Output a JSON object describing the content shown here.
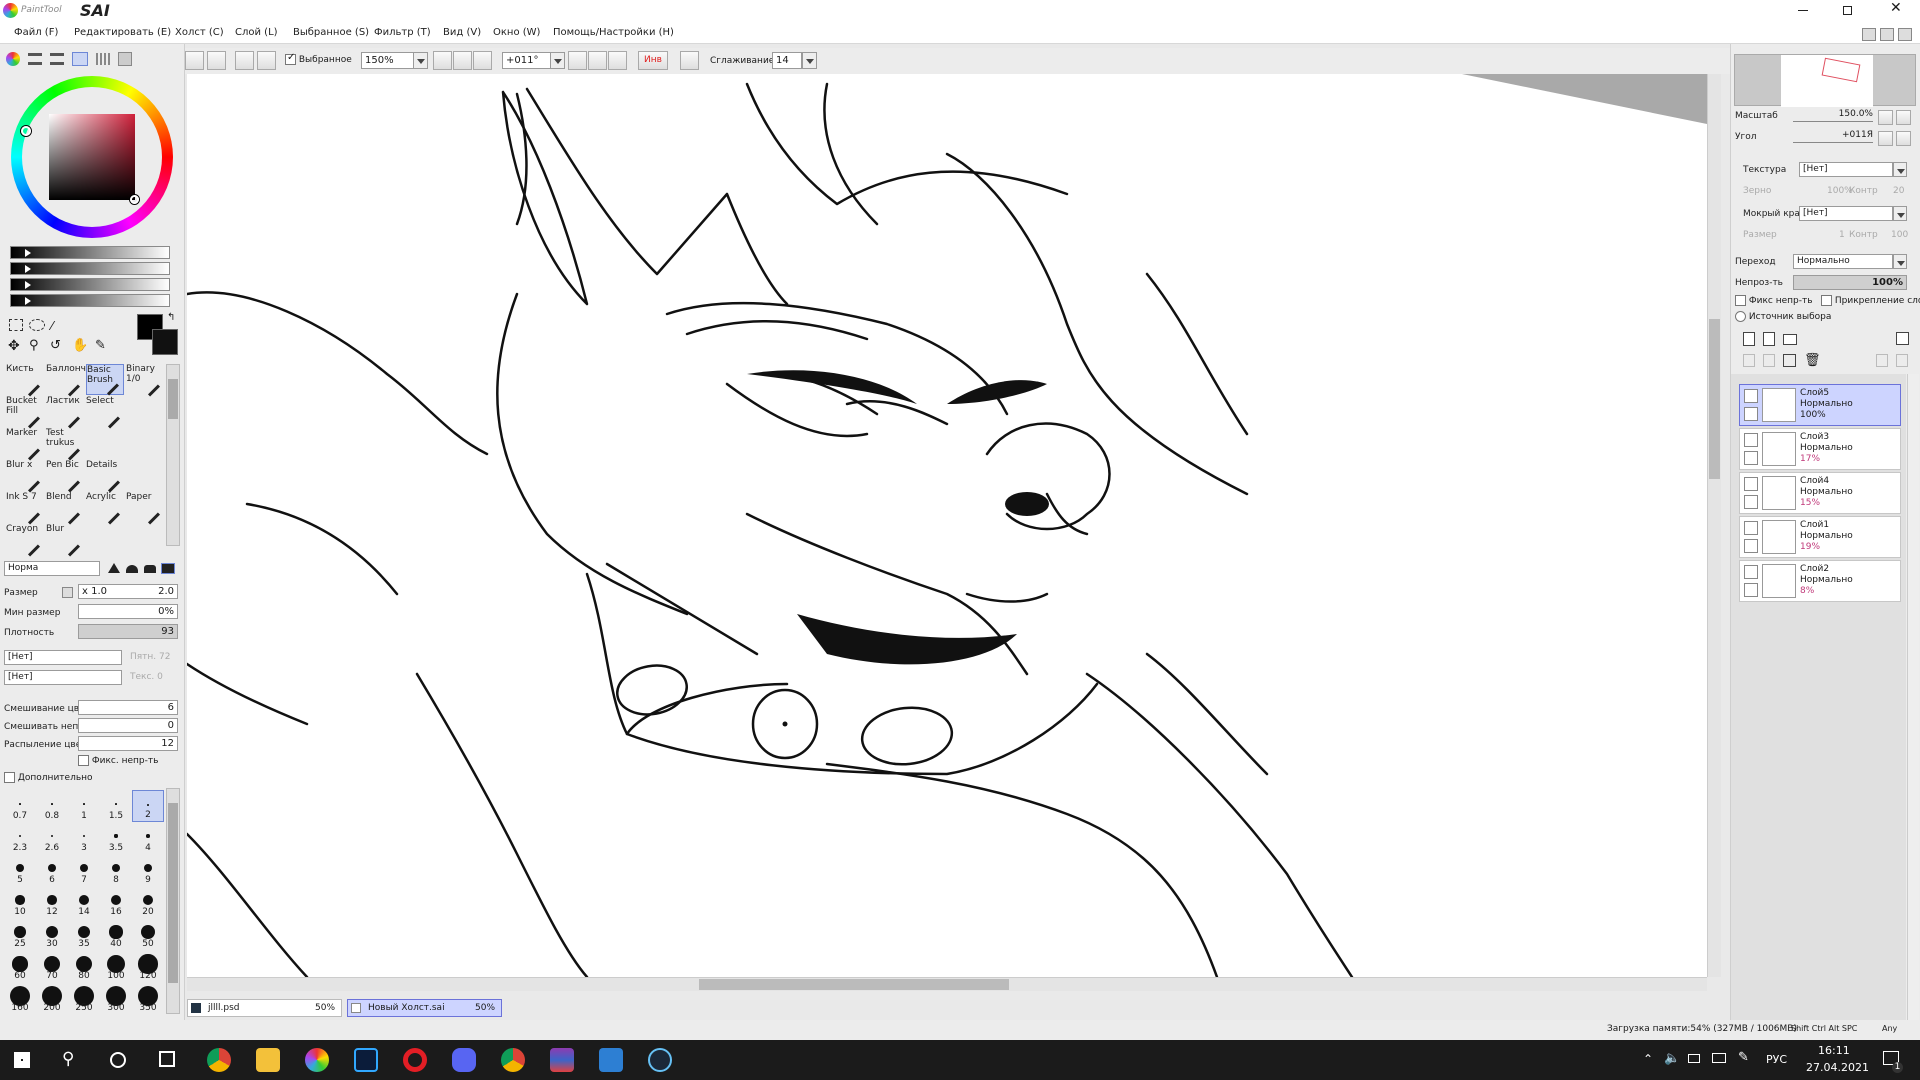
{
  "app": {
    "logo_text": "PaintTool",
    "logo_title": "SAI"
  },
  "menu": [
    {
      "label": "Файл (F)"
    },
    {
      "label": "Редактировать (E)"
    },
    {
      "label": "Холст (C)"
    },
    {
      "label": "Слой (L)"
    },
    {
      "label": "Выбранное (S)"
    },
    {
      "label": "Фильтр (T)"
    },
    {
      "label": "Вид (V)"
    },
    {
      "label": "Окно (W)"
    },
    {
      "label": "Помощь/Настройки (H)"
    }
  ],
  "toolbar": {
    "selection_label": "Выбранное",
    "zoom_value": "150%",
    "rotation_value": "+011°",
    "invert_label": "Инв",
    "smoothing_label": "Сглаживание",
    "smoothing_value": "14"
  },
  "tools": [
    {
      "label": "Кисть",
      "icon": "brush-icon"
    },
    {
      "label": "Баллонч",
      "icon": "airbrush-icon"
    },
    {
      "label": "Basic Brush",
      "icon": "basic-brush-icon"
    },
    {
      "label": "Binary 1/0",
      "icon": "pencil-icon"
    },
    {
      "label": "Bucket Fill",
      "icon": "bucket-icon"
    },
    {
      "label": "Ластик",
      "icon": "eraser-icon"
    },
    {
      "label": "Select",
      "icon": "select-icon"
    },
    {
      "label": "",
      "icon": ""
    },
    {
      "label": "Marker",
      "icon": "marker-icon"
    },
    {
      "label": "Test trukus",
      "icon": "pen-icon"
    },
    {
      "label": "",
      "icon": ""
    },
    {
      "label": "",
      "icon": ""
    },
    {
      "label": "Blur x",
      "icon": "blur-icon"
    },
    {
      "label": "Pen Bic",
      "icon": "pen-icon"
    },
    {
      "label": "Details",
      "icon": "details-icon"
    },
    {
      "label": "",
      "icon": ""
    },
    {
      "label": "Ink S 7",
      "icon": "ink-icon"
    },
    {
      "label": "Blend",
      "icon": "blend-icon"
    },
    {
      "label": "Acrylic",
      "icon": "acrylic-icon"
    },
    {
      "label": "Paper",
      "icon": "paper-icon"
    },
    {
      "label": "Crayon",
      "icon": "crayon-icon"
    },
    {
      "label": "Blur",
      "icon": "blur-icon"
    },
    {
      "label": "",
      "icon": ""
    },
    {
      "label": "",
      "icon": ""
    }
  ],
  "brush": {
    "mode": "Норма",
    "size_label": "Размер",
    "size_mult": "x 1.0",
    "size_value": "2.0",
    "min_size_label": "Мин размер",
    "min_size_value": "0%",
    "density_label": "Плотность",
    "density_value": "93",
    "shape_1": "[Нет]",
    "shape_1_param": "Пятн. 72",
    "shape_2": "[Нет]",
    "shape_2_param": "Текс. 0",
    "blend_label": "Смешивание цвет",
    "blend_value": "6",
    "dilution_label": "Смешивать непрз",
    "dilution_value": "0",
    "persistence_label": "Распыление цвет",
    "persistence_value": "12",
    "keep_opacity_label": "Фикс. непр-ть",
    "advanced_label": "Дополнительно"
  },
  "brush_sizes": [
    "0.7",
    "0.8",
    "1",
    "1.5",
    "2",
    "2.3",
    "2.6",
    "3",
    "3.5",
    "4",
    "5",
    "6",
    "7",
    "8",
    "9",
    "10",
    "12",
    "14",
    "16",
    "20",
    "25",
    "30",
    "35",
    "40",
    "50",
    "60",
    "70",
    "80",
    "100",
    "120",
    "160",
    "200",
    "250",
    "300",
    "350"
  ],
  "brush_sizes_selected": "2",
  "navigator": {
    "zoom_label": "Масштаб",
    "zoom_value": "150.0%",
    "angle_label": "Угол",
    "angle_value": "+011Я"
  },
  "layer_props": {
    "texture_label": "Текстура",
    "texture_value": "[Нет]",
    "grain_label": "Зерно",
    "grain_value": "100%",
    "contrast_label": "Контр",
    "contrast_value": "20",
    "wet_edge_label": "Мокрый край",
    "wet_edge_value": "[Нет]",
    "size_label": "Размер",
    "size_value": "1",
    "contrast2_label": "Контр",
    "contrast2_value": "100",
    "blend_label": "Переход",
    "blend_value": "Нормально",
    "opacity_label": "Непроз-ть",
    "opacity_value": "100%",
    "protect_opacity_label": "Фикс непр-ть",
    "clip_label": "Прикрепление слоя",
    "selection_source_label": "Источник выбора"
  },
  "layers": [
    {
      "name": "Слой5",
      "mode": "Нормально",
      "opacity": "100%",
      "selected": true
    },
    {
      "name": "Слой3",
      "mode": "Нормально",
      "opacity": "17%",
      "selected": false
    },
    {
      "name": "Слой4",
      "mode": "Нормально",
      "opacity": "15%",
      "selected": false
    },
    {
      "name": "Слой1",
      "mode": "Нормально",
      "opacity": "19%",
      "selected": false
    },
    {
      "name": "Слой2",
      "mode": "Нормально",
      "opacity": "8%",
      "selected": false
    }
  ],
  "documents": [
    {
      "name": "jllll.psd",
      "zoom": "50%",
      "active": false
    },
    {
      "name": "Новый Холст.sai",
      "zoom": "50%",
      "active": true
    }
  ],
  "status": {
    "memory": "Загрузка памяти:54% (327MB / 1006MB)",
    "keys": "Shift Ctrl Alt SPC",
    "any": "Any"
  },
  "taskbar": {
    "lang": "РУС",
    "time": "16:11",
    "date": "27.04.2021",
    "notifications": "1"
  }
}
